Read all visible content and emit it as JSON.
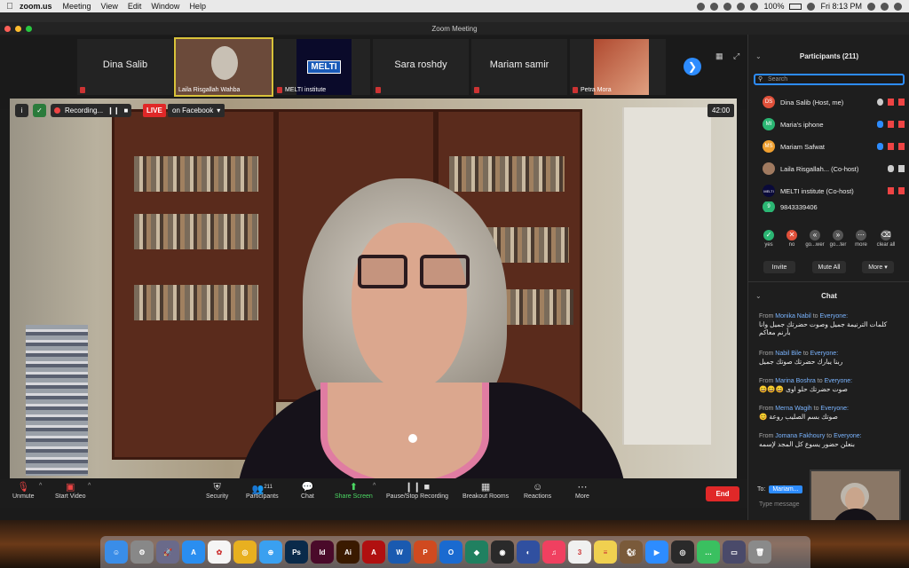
{
  "menubar": {
    "app_name": "zoom.us",
    "items": [
      "Meeting",
      "View",
      "Edit",
      "Window",
      "Help"
    ],
    "battery": "100%",
    "clock": "Fri 8:13 PM"
  },
  "window": {
    "title": "Zoom Meeting"
  },
  "thumbnails": [
    {
      "name": "Dina Salib",
      "caption": ""
    },
    {
      "name": "",
      "caption": "Laila Risgallah Wahba"
    },
    {
      "name": "",
      "caption": "MELTI institute",
      "logo": "MELTI"
    },
    {
      "name": "Sara roshdy",
      "caption": ""
    },
    {
      "name": "Mariam samir",
      "caption": ""
    },
    {
      "name": "",
      "caption": "Petra Mora"
    }
  ],
  "video_overlay": {
    "recording_label": "Recording...",
    "live_label": "LIVE",
    "live_target": "on Facebook",
    "timer": "42:00"
  },
  "toolbar": {
    "unmute": "Unmute",
    "start_video": "Start Video",
    "security": "Security",
    "participants": "Participants",
    "participants_count": "211",
    "chat": "Chat",
    "share_screen": "Share Screen",
    "pause_recording": "Pause/Stop Recording",
    "breakout_rooms": "Breakout Rooms",
    "reactions": "Reactions",
    "more": "More",
    "end": "End"
  },
  "participants_panel": {
    "title": "Participants (211)",
    "search_placeholder": "Search",
    "rows": [
      {
        "initials": "DS",
        "name": "Dina Salib (Host, me)",
        "color": "#e0503a"
      },
      {
        "initials": "MI",
        "name": "Maria's iphone",
        "color": "#2bb673"
      },
      {
        "initials": "MS",
        "name": "Mariam Safwat",
        "color": "#f0a030"
      },
      {
        "initials": "",
        "name": "Laila Risgallah... (Co-host)",
        "color": "#a07a60"
      },
      {
        "initials": "",
        "name": "MELTI institute (Co-host)",
        "color": "#0a0a3a"
      },
      {
        "initials": "9",
        "name": "9843339406",
        "color": "#2bb673"
      }
    ],
    "reactions": [
      {
        "label": "yes",
        "color": "#2bb673",
        "glyph": "✓"
      },
      {
        "label": "no",
        "color": "#e0503a",
        "glyph": "✕"
      },
      {
        "label": "go...wer",
        "color": "#555",
        "glyph": "«"
      },
      {
        "label": "go...ter",
        "color": "#555",
        "glyph": "»"
      },
      {
        "label": "more",
        "color": "#555",
        "glyph": "⋯"
      },
      {
        "label": "clear all",
        "color": "#555",
        "glyph": "⌫"
      }
    ],
    "buttons": {
      "invite": "Invite",
      "mute_all": "Mute All",
      "more": "More"
    }
  },
  "chat_panel": {
    "title": "Chat",
    "messages": [
      {
        "from_prefix": "From",
        "sender": "Monika Nabil",
        "to_word": "to",
        "recipient": "Everyone:",
        "text": "كلمات الترنيمة جميل وصوت حضرتك جميل وانا بأرنم معاكم"
      },
      {
        "from_prefix": "From",
        "sender": "Nabil Bile",
        "to_word": "to",
        "recipient": "Everyone:",
        "text": "ربنا يبارك حضرتك صوتك جميل"
      },
      {
        "from_prefix": "From",
        "sender": "Marina Boshra",
        "to_word": "to",
        "recipient": "Everyone:",
        "text": "صوت حضرتك حلو اوى 😄😄😄"
      },
      {
        "from_prefix": "From",
        "sender": "Merna Wagih",
        "to_word": "to",
        "recipient": "Everyone:",
        "text": "صوتك بسم الصليب روعة 😊"
      },
      {
        "from_prefix": "From",
        "sender": "Jomana Fakhoury",
        "to_word": "to",
        "recipient": "Everyone:",
        "text": "بنعلن حضور يسوع كل المجد لإسمه"
      }
    ],
    "to_label": "To:",
    "to_value": "Mariam...",
    "type_placeholder": "Type message"
  },
  "dock": [
    {
      "icon": "finder-icon",
      "color": "#3a8de8",
      "glyph": "☺"
    },
    {
      "icon": "system-preferences-icon",
      "color": "#888",
      "glyph": "⚙"
    },
    {
      "icon": "launchpad-icon",
      "color": "#6a6a8a",
      "glyph": "🚀"
    },
    {
      "icon": "app-store-icon",
      "color": "#2a8ef0",
      "glyph": "A"
    },
    {
      "icon": "photos-icon",
      "color": "#f5f5f5",
      "glyph": "✿"
    },
    {
      "icon": "chrome-icon",
      "color": "#e8b020",
      "glyph": "◎"
    },
    {
      "icon": "safari-icon",
      "color": "#3aa0f0",
      "glyph": "⊕"
    },
    {
      "icon": "photoshop-icon",
      "color": "#0a2a4a",
      "glyph": "Ps"
    },
    {
      "icon": "indesign-icon",
      "color": "#4a0a2a",
      "glyph": "Id"
    },
    {
      "icon": "illustrator-icon",
      "color": "#3a1a00",
      "glyph": "Ai"
    },
    {
      "icon": "acrobat-icon",
      "color": "#b01010",
      "glyph": "A"
    },
    {
      "icon": "word-icon",
      "color": "#1a5ab0",
      "glyph": "W"
    },
    {
      "icon": "powerpoint-icon",
      "color": "#d04a20",
      "glyph": "P"
    },
    {
      "icon": "outlook-icon",
      "color": "#1a6ad0",
      "glyph": "O"
    },
    {
      "icon": "gitkraken-icon",
      "color": "#208060",
      "glyph": "◆"
    },
    {
      "icon": "davinci-icon",
      "color": "#2a2a2a",
      "glyph": "◉"
    },
    {
      "icon": "siri-icon",
      "color": "#3050a0",
      "glyph": "◐"
    },
    {
      "icon": "music-icon",
      "color": "#f04060",
      "glyph": "♫"
    },
    {
      "icon": "calendar-icon",
      "color": "#f0f0f0",
      "glyph": "3"
    },
    {
      "icon": "notes-icon",
      "color": "#f0d050",
      "glyph": "≡"
    },
    {
      "icon": "squirrel-icon",
      "color": "#7a5a3a",
      "glyph": "🐿"
    },
    {
      "icon": "zoom-icon",
      "color": "#2d8cff",
      "glyph": "▶"
    },
    {
      "icon": "obs-icon",
      "color": "#2a2a2a",
      "glyph": "◎"
    },
    {
      "icon": "messages-icon",
      "color": "#3ac060",
      "glyph": "…"
    },
    {
      "icon": "screenshot-icon",
      "color": "#4a4a6a",
      "glyph": "▭"
    },
    {
      "icon": "trash-icon",
      "color": "#8a8a8a",
      "glyph": "🗑"
    }
  ]
}
